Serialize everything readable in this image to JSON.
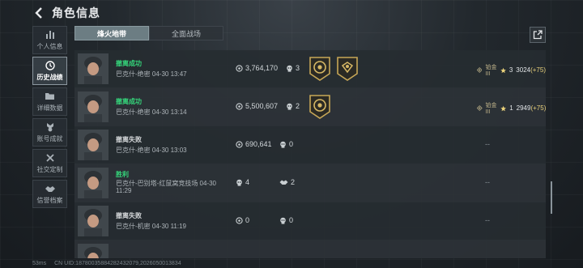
{
  "header": {
    "title": "角色信息"
  },
  "sidebar": {
    "items": [
      {
        "label": "个人信息",
        "icon": "bar-chart-icon"
      },
      {
        "label": "历史战绩",
        "icon": "history-icon"
      },
      {
        "label": "详细数据",
        "icon": "folder-icon"
      },
      {
        "label": "账号成就",
        "icon": "medal-icon"
      },
      {
        "label": "社交定制",
        "icon": "tools-icon"
      },
      {
        "label": "信誉档案",
        "icon": "handshake-icon"
      }
    ]
  },
  "tabs": [
    {
      "label": "烽火地带",
      "active": true
    },
    {
      "label": "全面战场",
      "active": false
    }
  ],
  "rows": [
    {
      "result": "撤离成功",
      "result_type": "win",
      "meta": "巴克什-绝密 04-30 13:47",
      "money": "3,764,170",
      "kills": "3",
      "rank_label": "铂金III",
      "star_count": "3",
      "points": "3024",
      "delta": "(+75)"
    },
    {
      "result": "撤离成功",
      "result_type": "win",
      "meta": "巴克什-绝密 04-30 13:14",
      "money": "5,500,607",
      "kills": "2",
      "rank_label": "铂金III",
      "star_count": "1",
      "points": "2949",
      "delta": "(+75)"
    },
    {
      "result": "撤离失败",
      "result_type": "lose",
      "meta": "巴克什-绝密 04-30 13:03",
      "money": "690,641",
      "kills": "0",
      "right": "--"
    },
    {
      "result": "胜利",
      "result_type": "win",
      "meta": "巴克什-巴别塔-红鼠窝竞技场 04-30 11:29",
      "kills": "4",
      "assists": "2",
      "right": "--"
    },
    {
      "result": "撤离失败",
      "result_type": "lose",
      "meta": "巴克什-机密 04-30 11:19",
      "money": "0",
      "kills": "0",
      "right": "--"
    }
  ],
  "footer": {
    "ping": "53ms",
    "uid": "CN UID:18780035884282432079,2026050013834"
  },
  "colors": {
    "win": "#35d67b",
    "gold": "#e8d07a",
    "accent_tab": "#6c7d83"
  }
}
